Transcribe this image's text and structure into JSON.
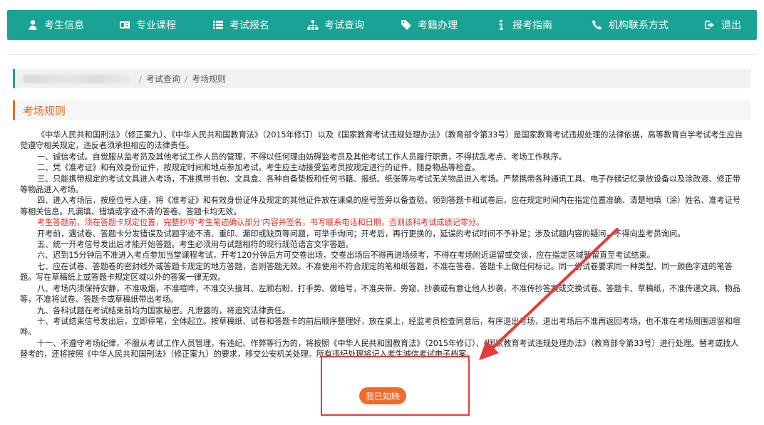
{
  "nav": {
    "items": [
      {
        "label": "考生信息",
        "icon": "user-icon"
      },
      {
        "label": "专业课程",
        "icon": "id-card-icon"
      },
      {
        "label": "考试报名",
        "icon": "list-icon"
      },
      {
        "label": "考试查询",
        "icon": "sitemap-icon"
      },
      {
        "label": "考籍办理",
        "icon": "tag-icon"
      },
      {
        "label": "报考指南",
        "icon": "info-icon"
      },
      {
        "label": "机构联系方式",
        "icon": "phone-icon"
      },
      {
        "label": "退出",
        "icon": "sign-out-icon"
      }
    ]
  },
  "breadcrumb": {
    "crumb1": "考试查询",
    "crumb2": "考场规则",
    "sep": "/"
  },
  "section": {
    "title": "考场规则"
  },
  "content": {
    "intro": "《中华人民共和国刑法》（修正案九）、《中华人民共和国教育法》（2015年修订）以及《国家教育考试违规处理办法》（教育部令第33号）是国家教育考试违规处理的法律依据，高等教育自学考试考生应自觉遵守相关规定，违反者须承担相应的法律责任。",
    "r1": "一、诚信考试。自觉服从监考员及其他考试工作人员的管理，不得以任何理由妨碍监考员及其他考试工作人员履行职责，不得扰乱考点、考场工作秩序。",
    "r2": "二、凭《准考证》和有效身份证件，按规定时间和地点参加考试。考生应主动接受监考员按规定进行的证件、随身物品等检查。",
    "r3": "三、只能携带规定的考试文具进入考场，不准携带书包、文具盒、各种自备垫板和任何书籍、报纸、纸张等与考试无关物品进入考场。严禁携带各种通讯工具、电子存储记忆录放设备以及涂改液、修正带等物品进入考场。",
    "r4": "四、进入考场后，按座位号入座，将《准考证》和有效身份证件及规定的其他证件放在课桌的座号签旁以备查验。领到答题卡和试卷后，应在规定时间内在指定位置准确、清楚地填（涂）姓名、准考证号等相关信息。凡漏填、错填或字迹不清的答卷、答题卡均无效。",
    "red": "考生答题前，须在答题卡规定位置，完整抄写'考生笔迹确认部分'内容并签名，书写联系电话和日期，否则该科考试成绩记零分。",
    "r4b": "开考前，遇试卷、答题卡分发错误及试题字迹不清、重印、漏印或缺页等问题，可举手询问；开考后，再行更换的，延误的考试时间不予补足；涉及试题内容的疑问，不得向监考员询问。",
    "r5": "五、统一开考信号发出后才能开始答题。考生必须用与试题相符的现行规范语言文字答题。",
    "r6": "六、迟到15分钟后不准进入考点参加当堂课程考试，开考120分钟后方可交卷出场，交卷出场后不得再进场续考，不得在考场附近逗留或交谈，应在指定区域暂留直至考试结束。",
    "r7": "七、应在试卷、答题卷的密封线外或答题卡规定的地方答题，否则答题无效。不准使用不符合规定的笔和纸答题，不准在答卷、答题卡上做任何标记。同一份试卷要求同一种类型、同一颜色字迹的笔答题。写在草稿纸上或答题卡规定区域以外的答案一律无效。",
    "r8": "八、考场内须保持安静，不准吸烟，不准喧哗，不准交头接耳、左顾右盼、打手势、做暗号，不准夹带、旁窥、抄袭或有意让他人抄袭，不准传抄答案或交换试卷、答题卡、草稿纸，不准传递文具、物品等，不准将试卷、答题卡或草稿纸带出考场。",
    "r9": "九、各科试题在考试结束前均为国家秘密。凡泄露的，将追究法律责任。",
    "r10": "十、考试结束信号发出后，立即停笔，全体起立。按草稿纸、试卷和答题卡的前后顺序整理好，放在桌上，经监考员检查同意后，有序退出考场，退出考场后不准再返回考场，也不准在考场周围逗留和喧哗。",
    "r11": "十一、不遵守考场纪律，不服从考试工作人员管理，有违纪、作弊等行为的，将按照《中华人民共和国教育法》（2015年修订）、《国家教育考试违规处理办法》（教育部令第33号）进行处理。替考或找人替考的，还将按照《中华人民共和国刑法》（修正案九）的要求，移交公安机关处理。所有违纪处理将记入考生诚信考试电子档案。"
  },
  "button": {
    "label": "我已知晓"
  },
  "colors": {
    "nav": "#1aa394",
    "accent": "#e06a2c",
    "button": "#ef6b2a",
    "red_text": "#e0251b",
    "annotation": "#e53b3b"
  }
}
